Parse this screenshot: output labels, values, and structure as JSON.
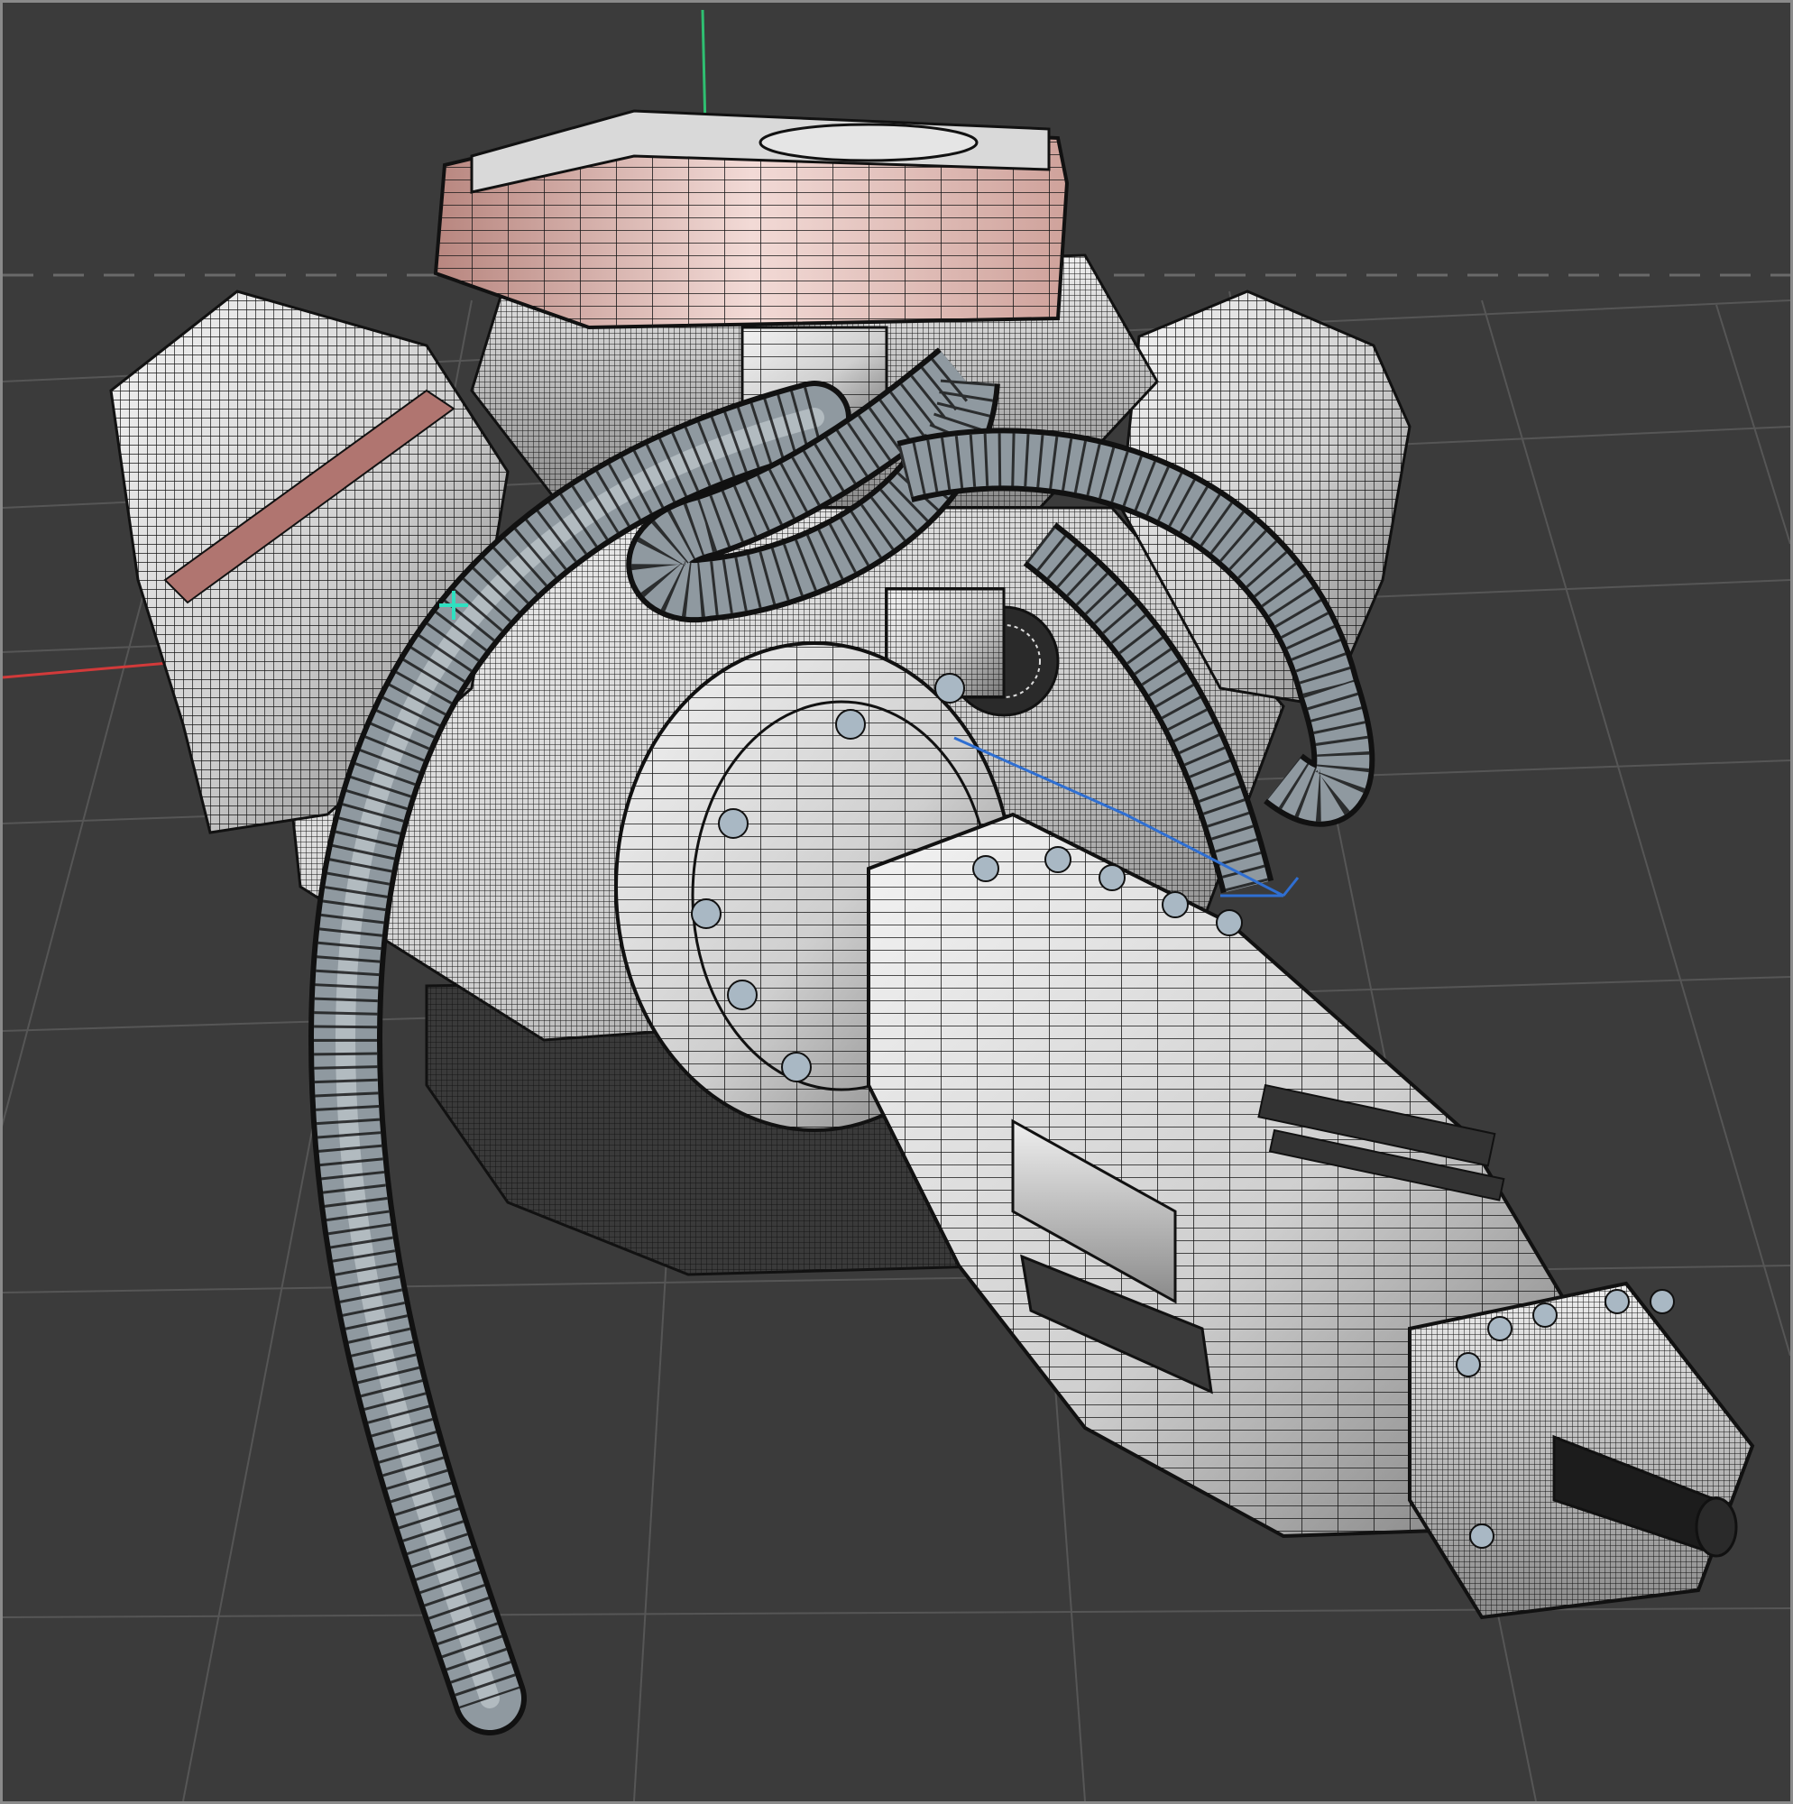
{
  "viewport": {
    "background_color": "#3b3b3b",
    "frame_color": "#8a8a8a",
    "grid_color": "#555555",
    "horizon_color": "#6a6a6a",
    "display_mode": "wireframe-on-shaded"
  },
  "axes": {
    "x_color": "#d23a3a",
    "y_color": "#2fbf71",
    "z_color": "#2f6fd2"
  },
  "gizmo": {
    "icon": "crosshair-icon",
    "color": "#2fe0c0"
  },
  "model": {
    "wire_color": "#111111",
    "shade_light": "#f0f0f0",
    "shade_dark": "#7a7a7a",
    "accent_color": "#c87a70",
    "hose_color": "#8f99a0"
  }
}
